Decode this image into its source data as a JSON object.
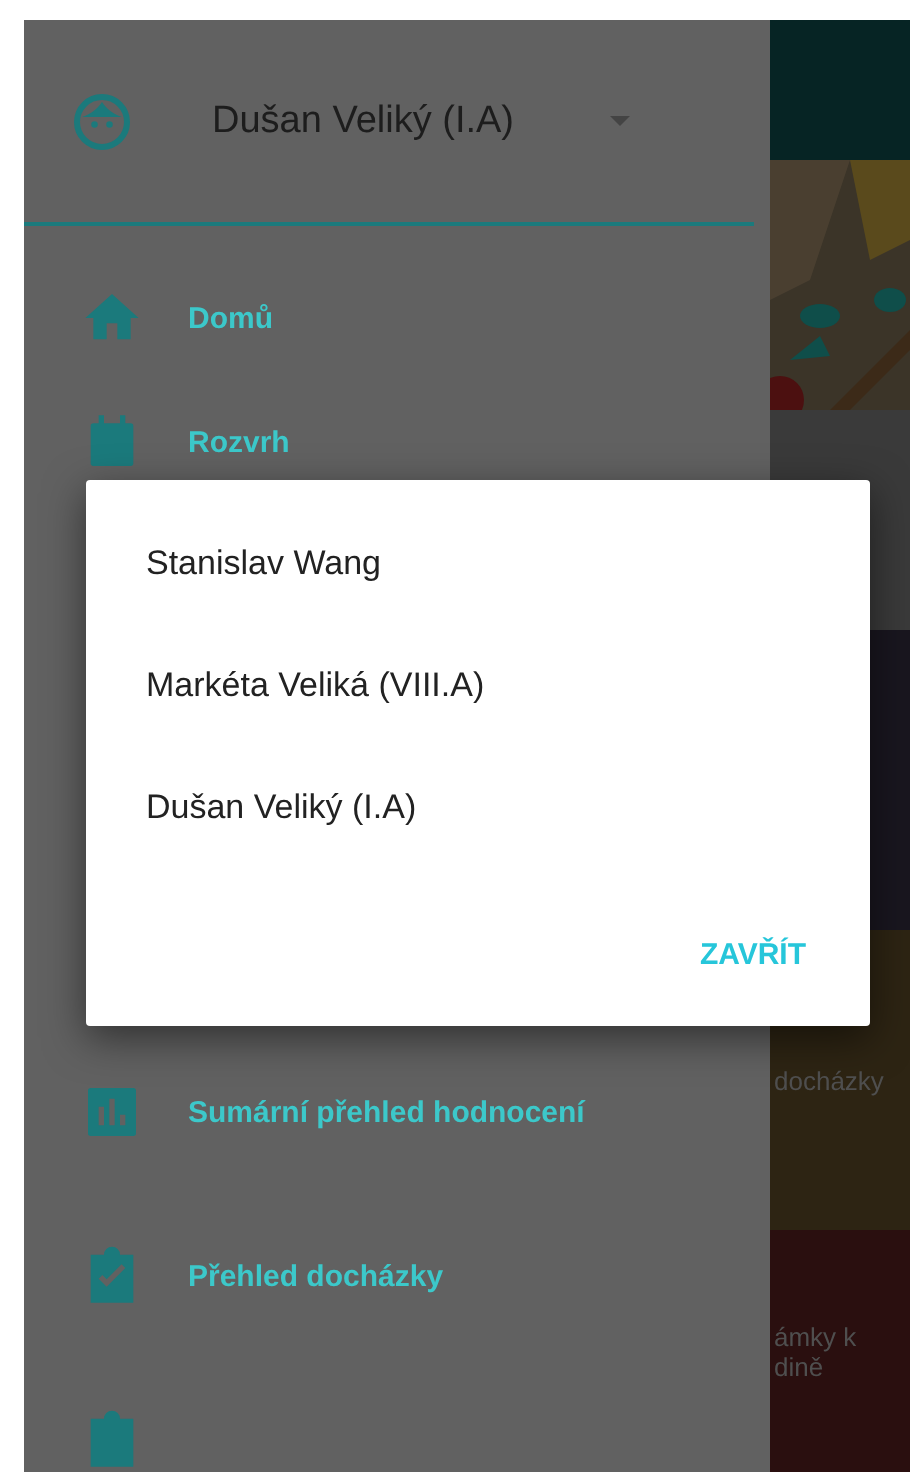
{
  "drawer": {
    "account": {
      "name": "Dušan Veliký (I.A)"
    },
    "top_items": [
      {
        "label": "Domů",
        "kind": "home"
      },
      {
        "label": "Rozvrh",
        "kind": "calendar"
      }
    ],
    "bottom_items": [
      {
        "label": "Sumární přehled hodnocení",
        "kind": "chart"
      },
      {
        "label": "Přehled docházky",
        "kind": "check"
      },
      {
        "kind": "clipboard"
      }
    ]
  },
  "background_tiles": [
    {
      "kind": "header"
    },
    {
      "kind": "picture"
    },
    {
      "kind": "plain"
    },
    {
      "kind": "plain"
    },
    {
      "kind": "label",
      "label": "docházky"
    },
    {
      "kind": "label",
      "label": "ámky k",
      "sublabel": "dině"
    }
  ],
  "dialog": {
    "options": [
      {
        "label": "Stanislav Wang"
      },
      {
        "label": "Markéta Veliká (VIII.A)"
      },
      {
        "label": "Dušan Veliký (I.A)"
      }
    ],
    "button": "ZAVŘÍT"
  }
}
